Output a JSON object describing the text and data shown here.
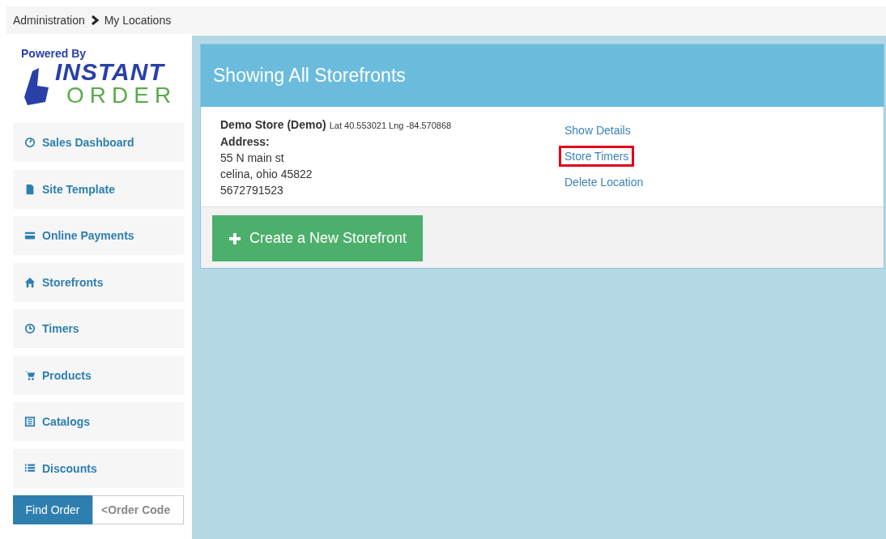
{
  "breadcrumb": [
    "Administration",
    "My Locations"
  ],
  "logo": {
    "tagline": "Powered By",
    "word_top": "INSTANT",
    "word_bottom": "ORDER"
  },
  "sidebar": {
    "items": [
      {
        "label": "Sales Dashboard"
      },
      {
        "label": "Site Template"
      },
      {
        "label": "Online Payments"
      },
      {
        "label": "Storefronts"
      },
      {
        "label": "Timers"
      },
      {
        "label": "Products"
      },
      {
        "label": "Catalogs"
      },
      {
        "label": "Discounts"
      }
    ],
    "find_button": "Find Order",
    "order_field": {
      "placeholder": "<Order Code"
    }
  },
  "panel": {
    "title": "Showing All Storefronts",
    "locations": [
      {
        "name": "Demo Store (Demo)",
        "coords": "Lat 40.553021 Lng -84.570868",
        "address_label": "Address:",
        "lines": [
          "55 N main st",
          "celina, ohio 45822",
          "5672791523"
        ],
        "links": [
          {
            "label": "Show Details",
            "highlighted": false
          },
          {
            "label": "Store Timers",
            "highlighted": true
          },
          {
            "label": "Delete Location",
            "highlighted": false
          }
        ]
      }
    ],
    "create_button": "Create a New Storefront"
  }
}
